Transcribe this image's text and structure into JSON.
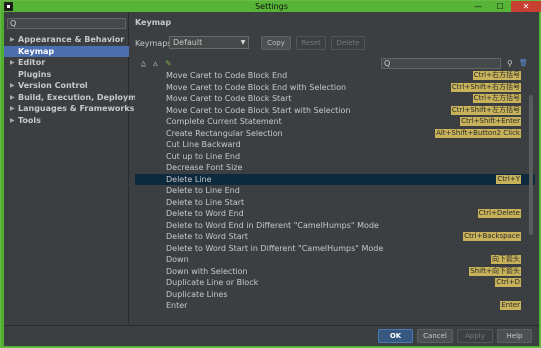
{
  "window": {
    "title": "Settings",
    "minimize": "—",
    "maximize": "☐",
    "close": "✕"
  },
  "sidebar": {
    "search_icon": "Q",
    "items": [
      {
        "label": "Appearance & Behavior",
        "arrow": "▶",
        "selected": false
      },
      {
        "label": "Keymap",
        "arrow": "",
        "selected": true
      },
      {
        "label": "Editor",
        "arrow": "▶",
        "selected": false
      },
      {
        "label": "Plugins",
        "arrow": "",
        "selected": false
      },
      {
        "label": "Version Control",
        "arrow": "▶",
        "selected": false
      },
      {
        "label": "Build, Execution, Deployment",
        "arrow": "▶",
        "selected": false
      },
      {
        "label": "Languages & Frameworks",
        "arrow": "▶",
        "selected": false
      },
      {
        "label": "Tools",
        "arrow": "▶",
        "selected": false
      }
    ]
  },
  "main": {
    "heading": "Keymap",
    "keymaps_label": "Keymaps:",
    "keymap_value": "Default",
    "buttons": {
      "copy": "Copy",
      "reset": "Reset",
      "delete": "Delete"
    },
    "toolbar_icons": {
      "expand": "⩠",
      "collapse": "⩟",
      "edit": "✎",
      "search": "Q",
      "find_shortcut": "⚲",
      "clear": "🗑"
    }
  },
  "actions": [
    {
      "name": "Move Caret to Code Block End",
      "shortcut": "Ctrl+右方括号"
    },
    {
      "name": "Move Caret to Code Block End with Selection",
      "shortcut": "Ctrl+Shift+右方括号"
    },
    {
      "name": "Move Caret to Code Block Start",
      "shortcut": "Ctrl+左方括号"
    },
    {
      "name": "Move Caret to Code Block Start with Selection",
      "shortcut": "Ctrl+Shift+左方括号"
    },
    {
      "name": "Complete Current Statement",
      "shortcut": "Ctrl+Shift+Enter"
    },
    {
      "name": "Create Rectangular Selection",
      "shortcut": "Alt+Shift+Button2 Click"
    },
    {
      "name": "Cut Line Backward",
      "shortcut": ""
    },
    {
      "name": "Cut up to Line End",
      "shortcut": ""
    },
    {
      "name": "Decrease Font Size",
      "shortcut": ""
    },
    {
      "name": "Delete Line",
      "shortcut": "Ctrl+Y"
    },
    {
      "name": "Delete to Line End",
      "shortcut": ""
    },
    {
      "name": "Delete to Line Start",
      "shortcut": ""
    },
    {
      "name": "Delete to Word End",
      "shortcut": "Ctrl+Delete"
    },
    {
      "name": "Delete to Word End in Different \"CamelHumps\" Mode",
      "shortcut": ""
    },
    {
      "name": "Delete to Word Start",
      "shortcut": "Ctrl+Backspace"
    },
    {
      "name": "Delete to Word Start in Different \"CamelHumps\" Mode",
      "shortcut": ""
    },
    {
      "name": "Down",
      "shortcut": "向下箭头"
    },
    {
      "name": "Down with Selection",
      "shortcut": "Shift+向下箭头"
    },
    {
      "name": "Duplicate Line or Block",
      "shortcut": "Ctrl+D"
    },
    {
      "name": "Duplicate Lines",
      "shortcut": ""
    },
    {
      "name": "Enter",
      "shortcut": "Enter"
    }
  ],
  "selected_action": "Delete Line",
  "footer": {
    "ok": "OK",
    "cancel": "Cancel",
    "apply": "Apply",
    "help": "Help"
  },
  "colors": {
    "accent": "#4b6eaf",
    "shortcut_badge": "#c8b25a",
    "selected_row": "#0d293e",
    "titlebar": "#57b436"
  }
}
